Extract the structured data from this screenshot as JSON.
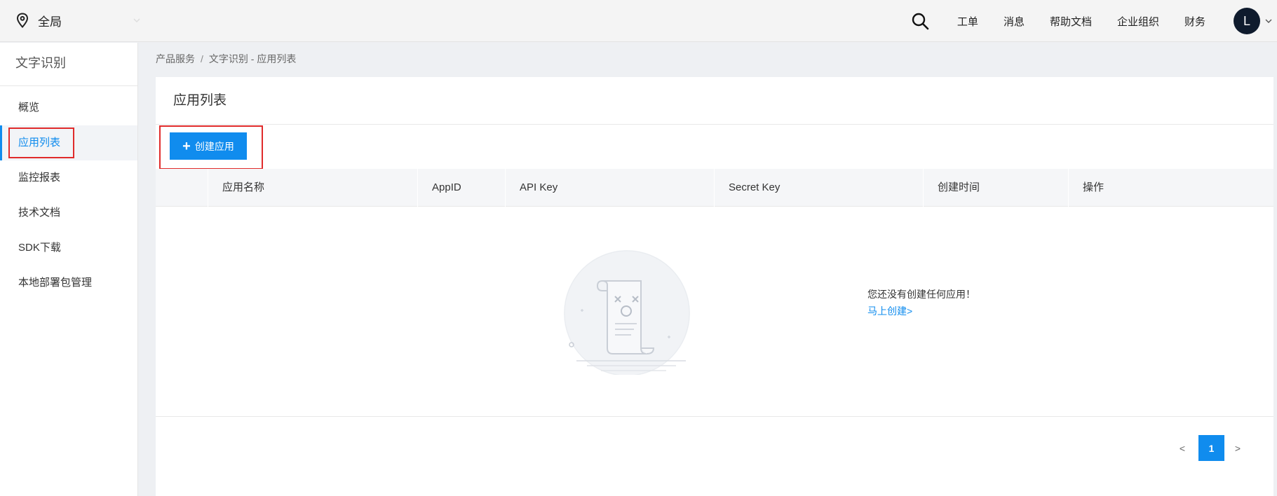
{
  "topbar": {
    "region_label": "全局",
    "nav_items": [
      "工单",
      "消息",
      "帮助文档",
      "企业组织",
      "财务"
    ],
    "avatar_initial": "L"
  },
  "sidebar": {
    "title": "文字识别",
    "items": [
      {
        "label": "概览"
      },
      {
        "label": "应用列表"
      },
      {
        "label": "监控报表"
      },
      {
        "label": "技术文档"
      },
      {
        "label": "SDK下载"
      },
      {
        "label": "本地部署包管理"
      }
    ],
    "active_index": 1
  },
  "breadcrumb": {
    "root": "产品服务",
    "separator": "/",
    "current": "文字识别 - 应用列表"
  },
  "main": {
    "title": "应用列表",
    "create_button_label": "创建应用",
    "table": {
      "columns": [
        "应用名称",
        "AppID",
        "API Key",
        "Secret Key",
        "创建时间",
        "操作"
      ],
      "rows": []
    },
    "empty_state": {
      "message": "您还没有创建任何应用！",
      "link_label": "马上创建>"
    },
    "pagination": {
      "prev_label": "<",
      "current_page": "1",
      "next_label": ">"
    }
  },
  "colors": {
    "accent": "#108cee",
    "highlight_box": "#e02b2b",
    "avatar_bg": "#0f1b2d"
  },
  "icons": [
    "location-pin-icon",
    "chevron-down-icon",
    "search-icon",
    "plus-icon",
    "empty-document-icon"
  ]
}
